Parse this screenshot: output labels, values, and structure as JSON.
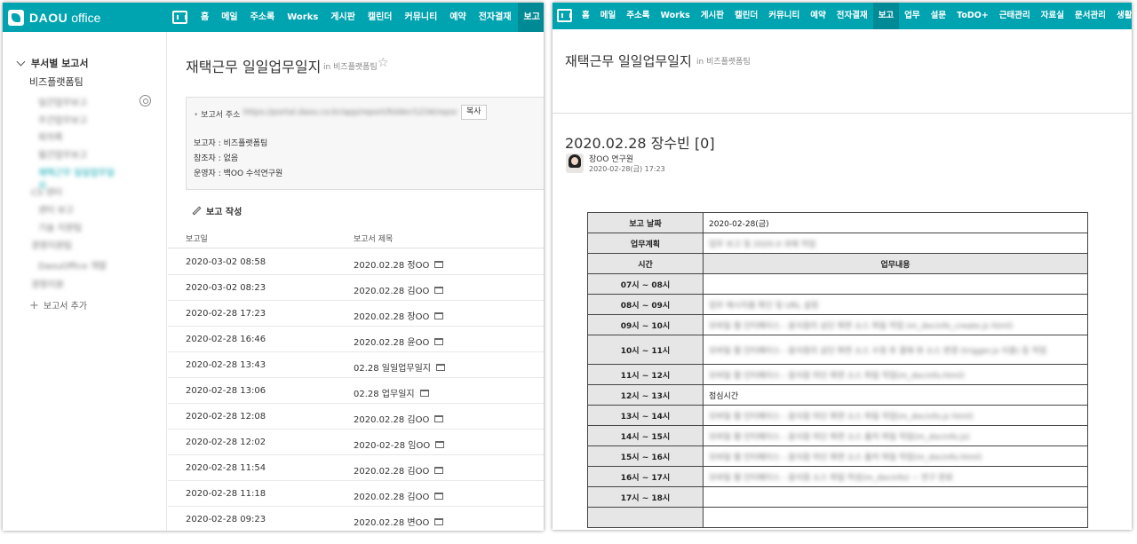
{
  "left": {
    "logo": {
      "brand": "DAOU",
      "brand2": "office"
    },
    "nav": [
      "홈",
      "메일",
      "주소록",
      "Works",
      "게시판",
      "캘린더",
      "커뮤니티",
      "예약",
      "전자결재",
      "보고",
      "업"
    ],
    "sidebar": {
      "section": "부서별 보고서",
      "team": "비즈플랫폼팀",
      "blurred_items": [
        "일간업무보고",
        "주간업무보고",
        "회의록",
        "월간업무보고",
        "재택근무 일일업무일지",
        "CS 센터",
        "센터 보고",
        "기술 지원팀",
        "경영지원팀",
        "DaouOffice 개발",
        "경영지원"
      ],
      "add_label": "보고서 추가"
    },
    "title": "재택근무 일일업무일지",
    "in_team": "in 비즈플랫폼팀",
    "info": {
      "url_label": "보고서 주소",
      "url_value": "https://portal.daou.co.kr/app/report/folder/1234/reports",
      "copy_label": "복사",
      "reporter": "보고자 : 비즈플랫폼팀",
      "ref": "참조자 : 없음",
      "operator": "운영자 : 백OO 수석연구원"
    },
    "write_label": "보고 작성",
    "table": {
      "col_date": "보고일",
      "col_title": "보고서 제목",
      "rows": [
        {
          "date": "2020-03-02 08:58",
          "title": "2020.02.28 정OO"
        },
        {
          "date": "2020-03-02 08:23",
          "title": "2020.02.28 김OO"
        },
        {
          "date": "2020-02-28 17:23",
          "title": "2020.02.28 장OO"
        },
        {
          "date": "2020-02-28 16:46",
          "title": "2020.02.28 윤OO"
        },
        {
          "date": "2020-02-28 13:43",
          "title": "02.28 일일업무일지"
        },
        {
          "date": "2020-02-28 13:06",
          "title": "02.28 업무일지"
        },
        {
          "date": "2020-02-28 12:08",
          "title": "2020.02.28 김OO"
        },
        {
          "date": "2020-02-28 12:02",
          "title": "2020-02-28 임OO"
        },
        {
          "date": "2020-02-28 11:54",
          "title": "2020.02.28 김OO"
        },
        {
          "date": "2020-02-28 11:18",
          "title": "2020.02.28 김OO"
        },
        {
          "date": "2020-02-28 09:23",
          "title": "2020.02.28 변OO"
        }
      ]
    }
  },
  "right": {
    "nav": [
      "홈",
      "메일",
      "주소록",
      "Works",
      "게시판",
      "캘린더",
      "커뮤니티",
      "예약",
      "전자결재",
      "보고",
      "업무",
      "설문",
      "ToDO+",
      "근태관리",
      "자료실",
      "문서관리",
      "생활"
    ],
    "title": "재택근무 일일업무일지",
    "in_team": "in 비즈플랫폼팀",
    "post_title": "2020.02.28 장수빈 [0]",
    "author": "장OO 연구원",
    "datetime": "2020-02-28(금) 17:23",
    "report": {
      "date_label": "보고 날짜",
      "date_value": "2020-02-28(금)",
      "plan_label": "업무계획",
      "plan_value": "업무 보고 및 2020.0 과제 작업",
      "time_header": "시간",
      "content_header": "업무내용",
      "rows": [
        {
          "time": "07시 ~ 08시",
          "content": "",
          "blur": false
        },
        {
          "time": "08시 ~ 09시",
          "content": "업무 메시지를 확인 및 URL 설정",
          "blur": true
        },
        {
          "time": "09시 ~ 10시",
          "content": "모바일 웹 인터페이스 - 음식점의 상단 화면 소스 파일 작업 (m_docinfo_create.js html)",
          "blur": true
        },
        {
          "time": "10시 ~ 11시",
          "content": "모바일 웹 인터페이스 - 음식점의 상단 화면 소스 수정 후 결재 뷰 소스 변경 (trigger.js 이용) 등 작업",
          "blur": true,
          "tall": true
        },
        {
          "time": "11시 ~ 12시",
          "content": "모바일 웹 인터페이스 - 음식점 하단 화면 소스 파일 작업(m_docinfo.html)",
          "blur": true
        },
        {
          "time": "12시 ~ 13시",
          "content": "점심시간",
          "blur": false
        },
        {
          "time": "13시 ~ 14시",
          "content": "모바일 웹 인터페이스 - 음식점 하단 화면 소스 파일 작업(m_docinfo.js html)",
          "blur": true
        },
        {
          "time": "14시 ~ 15시",
          "content": "모바일 웹 인터페이스 - 음식점 하단 화면 소스 출처 파일 작업(m_docinfo.js)",
          "blur": true
        },
        {
          "time": "15시 ~ 16시",
          "content": "모바일 웹 인터페이스 - 음식점 하단 화면 소스 출처 파일 작업(m_docinfo.html)",
          "blur": true
        },
        {
          "time": "16시 ~ 17시",
          "content": "모바일 웹 인터페이스 - 음식점 소스 파일 작성(m_docinfo) ~ 연구 완료",
          "blur": true
        },
        {
          "time": "17시 ~ 18시",
          "content": "",
          "blur": false
        },
        {
          "time": "",
          "content": "",
          "blur": false
        }
      ]
    }
  }
}
